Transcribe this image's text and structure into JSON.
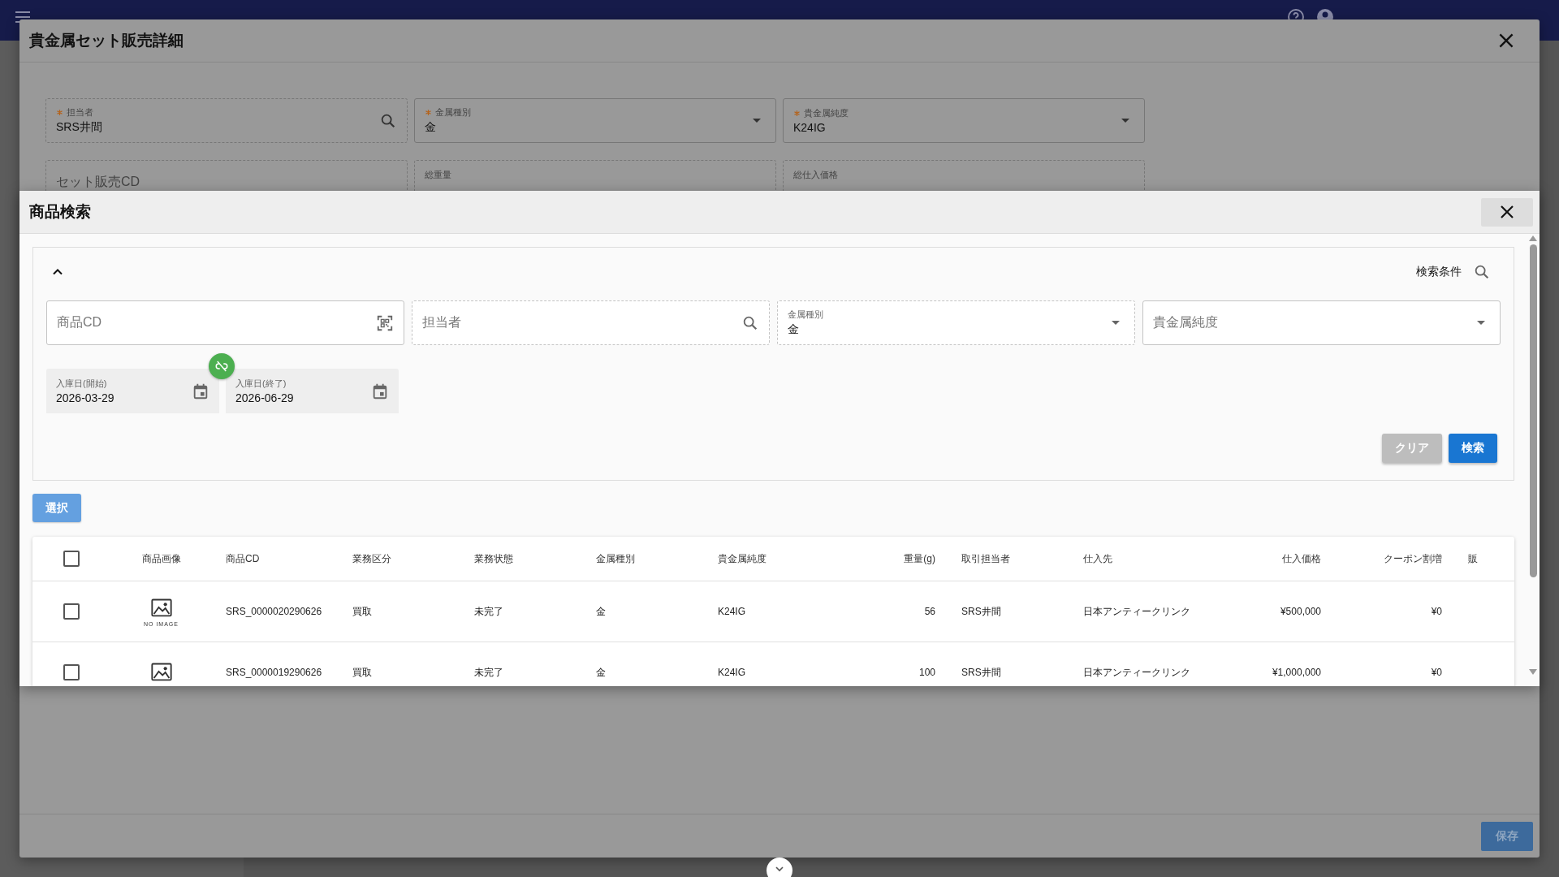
{
  "detail_dialog": {
    "title": "貴金属セット販売詳細",
    "fields": [
      {
        "kind": "search",
        "label": "担当者",
        "required": true,
        "readonly": true,
        "value": "SRS井間"
      },
      {
        "kind": "select",
        "label": "金属種別",
        "required": true,
        "readonly": false,
        "value": "金"
      },
      {
        "kind": "select",
        "label": "貴金属純度",
        "required": true,
        "readonly": false,
        "value": "K24IG"
      },
      {
        "kind": "text",
        "placeholder": "セット販売CD",
        "required": false,
        "readonly": true
      },
      {
        "kind": "number",
        "label": "総重量",
        "required": false,
        "readonly": true
      },
      {
        "kind": "number",
        "label": "総仕入価格",
        "required": false,
        "readonly": true
      }
    ],
    "save_button": "保存"
  },
  "search_dialog": {
    "title": "商品検索",
    "panel": {
      "expanded": true,
      "heading": "検索条件",
      "fields": [
        {
          "kind": "scan",
          "placeholder": "商品CD",
          "readonly": false
        },
        {
          "kind": "search",
          "placeholder": "担当者",
          "readonly": true
        },
        {
          "kind": "select",
          "label": "金属種別",
          "value": "金",
          "readonly": true
        },
        {
          "kind": "select",
          "placeholder": "貴金属純度",
          "readonly": false
        }
      ],
      "date_range": {
        "linked": false,
        "start": {
          "label": "入庫日(開始)",
          "value": "2026-03-29"
        },
        "end": {
          "label": "入庫日(終了)",
          "value": "2026-06-29"
        }
      },
      "clear_button": "クリア",
      "search_button": "検索"
    },
    "select_button": "選択",
    "table": {
      "all_checked": false,
      "image_column": "商品画像",
      "columns": [
        {
          "label": "商品CD",
          "numeric": false
        },
        {
          "label": "業務区分",
          "numeric": false
        },
        {
          "label": "業務状態",
          "numeric": false
        },
        {
          "label": "金属種別",
          "numeric": false
        },
        {
          "label": "貴金属純度",
          "numeric": false
        },
        {
          "label": "重量(g)",
          "numeric": true
        },
        {
          "label": "取引担当者",
          "numeric": false
        },
        {
          "label": "仕入先",
          "numeric": false
        },
        {
          "label": "仕入価格",
          "numeric": true
        },
        {
          "label": "クーポン割増",
          "numeric": true
        },
        {
          "label": "販",
          "numeric": false
        }
      ],
      "rows": [
        {
          "checked": false,
          "image_caption": "NO IMAGE",
          "cells": [
            "SRS_0000020290626",
            "買取",
            "未完了",
            "金",
            "K24IG",
            "56",
            "SRS井間",
            "日本アンティークリンク",
            "¥500,000",
            "¥0"
          ]
        },
        {
          "checked": false,
          "cells": [
            "SRS_0000019290626",
            "買取",
            "未完了",
            "金",
            "K24IG",
            "100",
            "SRS井間",
            "日本アンティークリンク",
            "¥1,000,000",
            "¥0"
          ]
        }
      ]
    }
  }
}
